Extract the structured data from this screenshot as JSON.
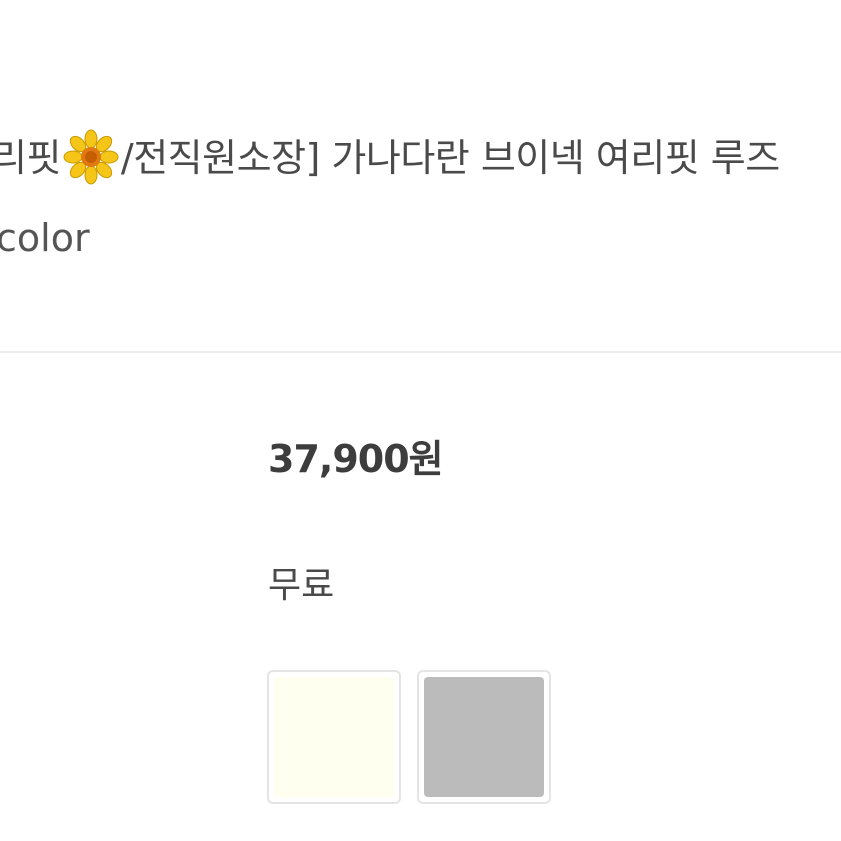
{
  "product": {
    "title_prefix": "리핏",
    "title_suffix": "/전직원소장] 가나다란 브이넥 여리핏 루즈",
    "title_emoji_icon": "sunflower-icon",
    "subtitle": "color",
    "price": "37,900원",
    "shipping": "무료"
  },
  "swatches": [
    {
      "name": "cream",
      "color": "#FFFFF0"
    },
    {
      "name": "gray",
      "color": "#BBBBBB"
    }
  ],
  "colors": {
    "divider": "#ECECEC",
    "text": "#4A4A4A"
  }
}
